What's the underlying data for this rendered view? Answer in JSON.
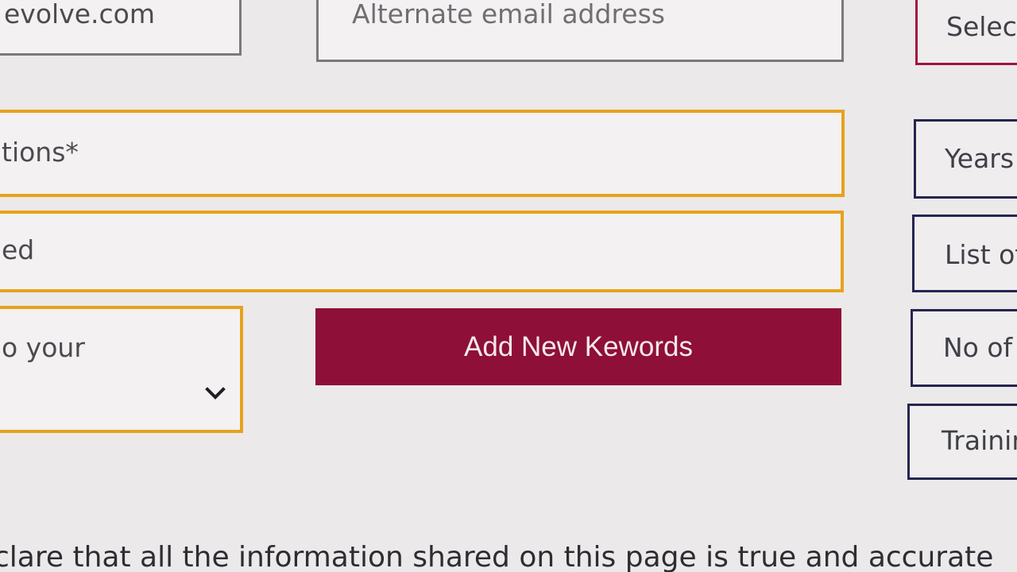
{
  "form": {
    "email": {
      "value": "evolve.com"
    },
    "alt_email": {
      "placeholder": "Alternate email address"
    },
    "qualifications": {
      "placeholder": "tions*"
    },
    "second_field": {
      "placeholder": "ed"
    },
    "select": {
      "label": "o your"
    },
    "add_keywords_label": "Add New Kewords"
  },
  "right_column": {
    "select_label": "Selec",
    "years_label": "Years",
    "list_label": "List of",
    "no_of_label": "No of",
    "training_label": "Trainin"
  },
  "declaration": "clare that all the information shared on this page is true and accurate",
  "colors": {
    "accent_gold": "#e7a21b",
    "button_maroon": "#8e0f37",
    "border_navy": "#252550",
    "border_maroon": "#a0123c"
  }
}
